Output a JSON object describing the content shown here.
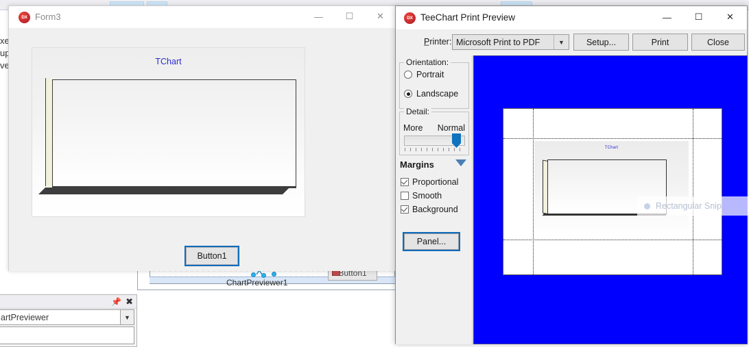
{
  "ide": {
    "left_text_fragments": [
      "xes",
      "up",
      "ver"
    ],
    "designer": {
      "component_label": "ChartPreviewer1",
      "button_label": "Button1"
    },
    "properties_panel": {
      "combo_value": "artPreviewer",
      "pin_icon": "pin-icon",
      "close_icon": "close-icon",
      "dropdown_icon": "chevron-down-icon"
    }
  },
  "form3": {
    "title": "Form3",
    "icon": "app-icon",
    "minimize_label": "—",
    "maximize_label": "☐",
    "close_label": "✕",
    "chart": {
      "title": "TChart"
    },
    "button1_label": "Button1"
  },
  "preview": {
    "title": "TeeChart Print Preview",
    "icon": "app-icon",
    "minimize_label": "—",
    "maximize_label": "☐",
    "close_label": "✕",
    "toolbar": {
      "printer_label": "P̲rinter:",
      "printer_value": "Microsoft Print to PDF",
      "printer_dropdown_icon": "chevron-down-icon",
      "setup_label": "Setup...",
      "print_label": "Print",
      "close_label": "Close"
    },
    "sidebar": {
      "orientation_legend": "Orientation:",
      "orientation_options": [
        {
          "label": "Portrait",
          "selected": false
        },
        {
          "label": "Landscape",
          "selected": true
        }
      ],
      "detail_legend": "Detail:",
      "detail_min_label": "More",
      "detail_max_label": "Normal",
      "margins_header": "Margins",
      "margins_chevron_icon": "chevron-down-icon",
      "checkboxes": [
        {
          "label": "Proportional",
          "checked": true
        },
        {
          "label": "Smooth",
          "checked": false
        },
        {
          "label": "Background",
          "checked": true
        }
      ],
      "panel_button_label": "Panel..."
    },
    "canvas": {
      "background_color": "#0000FF",
      "page_chart_title": "TChart"
    }
  },
  "overlay": {
    "snip_label": "Rectangular Snip",
    "snip_icon": "snip-dot-icon"
  },
  "colors": {
    "preview_background": "#0000FF",
    "accent_focus": "#0F6CBD",
    "chart_title": "#2B2BD0",
    "selection_handle": "#2FB1EF"
  }
}
